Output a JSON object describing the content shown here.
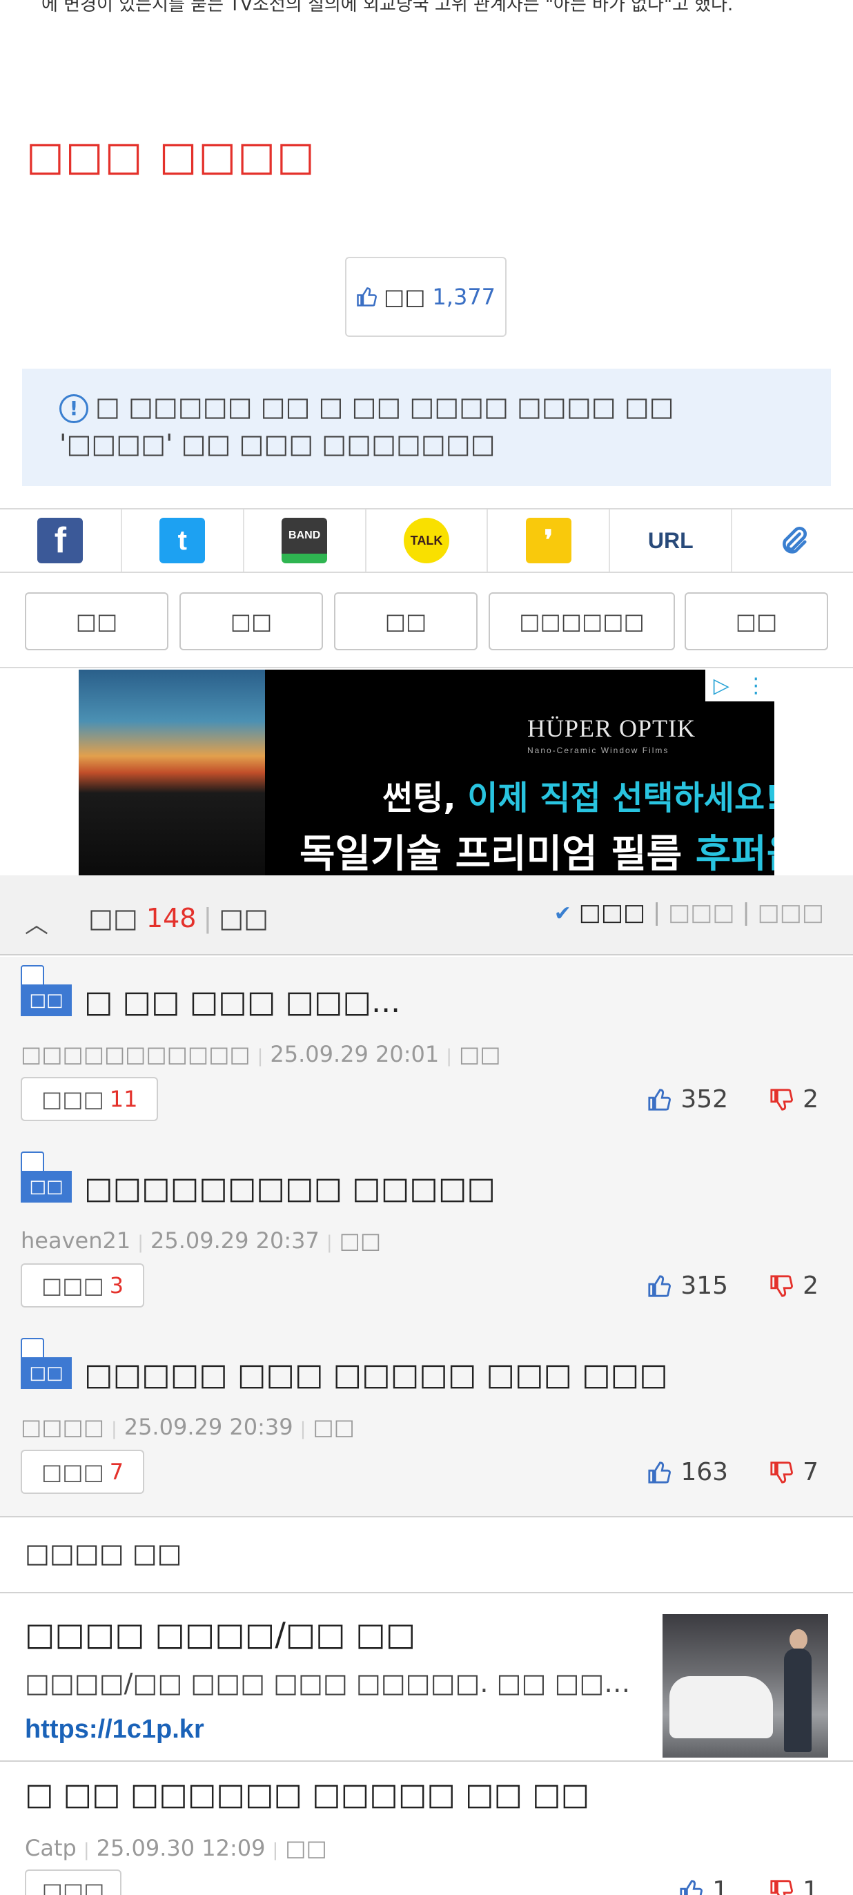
{
  "article": {
    "top_text": "에 변경이 있는지를 묻는 TV조선의 질의에 외교당국 고위 관계자는 \"아는 바가 없다\"고 했다.",
    "red_heading": "□□□ □□□□",
    "recommend_label": "□□",
    "recommend_count": "1,377",
    "notice_text": "□ □□□□□ □□ □ □□ □□□□ □□□□ □□ '□□□□' □□ □□□ □□□□□□□"
  },
  "share": {
    "facebook": "f",
    "twitter": "t",
    "band": "BAND",
    "talk": "TALK",
    "kakaostory": "❜",
    "url": "URL",
    "clip": "⌀"
  },
  "actions": [
    "□□",
    "□□",
    "□□",
    "□□□□□□",
    "□□"
  ],
  "ad": {
    "brand": "HÜPER OPTIK",
    "brand_sub": "Nano-Ceramic Window Films",
    "line1_a": "썬팅, ",
    "line1_b": "이제 직접 선택하세요!",
    "line2_a": "독일기술 프리미엄 필름 ",
    "line2_b": "후퍼옵틱."
  },
  "comments_header": {
    "label": "□□",
    "count": "148",
    "extra": "□□",
    "sort_active": "□□□",
    "sort_2": "□□□",
    "sort_3": "□□□"
  },
  "best_comments": [
    {
      "badge": "□□",
      "title": "□ □□ □□□ □□□...",
      "author": "□□□□□□□□□□□",
      "date": "25.09.29  20:01",
      "tag": "□□",
      "reply_label": "□□□",
      "reply_count": "11",
      "up": "352",
      "down": "2"
    },
    {
      "badge": "□□",
      "title": "□□□□□□□□□ □□□□□",
      "author": "heaven21",
      "date": "25.09.29  20:37",
      "tag": "□□",
      "reply_label": "□□□",
      "reply_count": "3",
      "up": "315",
      "down": "2"
    },
    {
      "badge": "□□",
      "title": "□□□□□ □□□ □□□□□ □□□ □□□",
      "author": "□□□□",
      "date": "25.09.29  20:39",
      "tag": "□□",
      "reply_label": "□□□",
      "reply_count": "7",
      "up": "163",
      "down": "7"
    }
  ],
  "related": {
    "label": "□□□□ □□"
  },
  "promo": {
    "title": "□□□□ □□□□/□□ □□",
    "desc": "□□□□/□□ □□□ □□□ □□□□□. □□ □□□□ □...",
    "link": "https://1c1p.kr"
  },
  "post": {
    "title": "□ □□ □□□□□□ □□□□□ □□ □□",
    "author": "Catp",
    "date": "25.09.30  12:09",
    "tag": "□□",
    "reply_label": "□□□",
    "up": "1",
    "down": "1"
  },
  "colors": {
    "accent_red": "#e4312b",
    "accent_blue": "#3a6fc4",
    "notice_bg": "#e9f1fb",
    "best_bg": "#f5f5f5"
  }
}
